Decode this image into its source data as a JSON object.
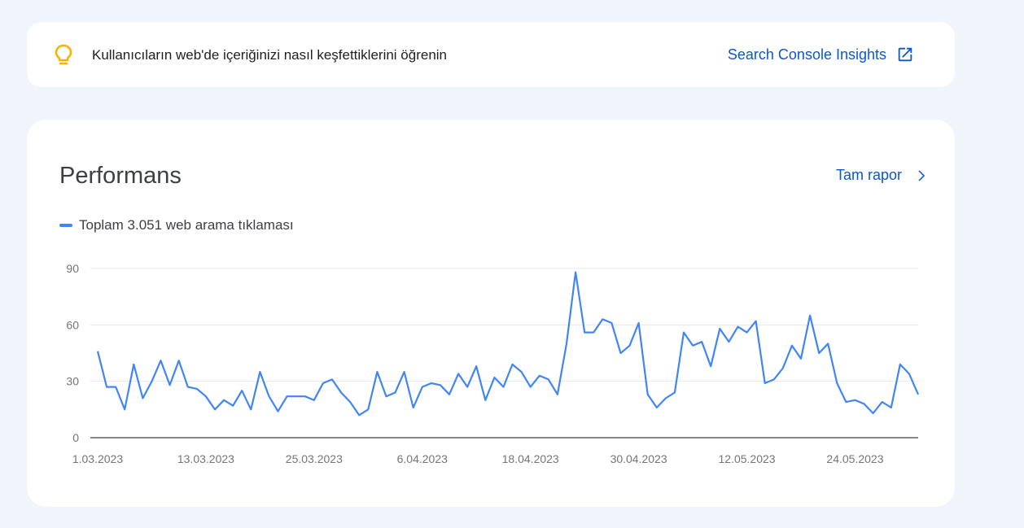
{
  "insights": {
    "icon": "lightbulb-icon",
    "icon_color": "#f4b400",
    "text": "Kullanıcıların web'de içeriğinizi nasıl keşfettiklerini öğrenin",
    "link_label": "Search Console Insights",
    "link_icon": "open-in-new-icon"
  },
  "performance": {
    "title": "Performans",
    "report_link_label": "Tam rapor",
    "report_link_icon": "chevron-right-icon",
    "legend_label": "Toplam 3.051 web arama tıklaması"
  },
  "colors": {
    "accent": "#0b57d0",
    "series": "#4285f4"
  },
  "chart_data": {
    "type": "line",
    "ylim": [
      0,
      90
    ],
    "yticks": [
      0,
      30,
      60,
      90
    ],
    "xtick_labels": [
      "1.03.2023",
      "13.03.2023",
      "25.03.2023",
      "6.04.2023",
      "18.04.2023",
      "30.04.2023",
      "12.05.2023",
      "24.05.2023"
    ],
    "xtick_index": [
      0,
      12,
      24,
      36,
      48,
      60,
      72,
      84
    ],
    "series": [
      {
        "name": "Toplam 3.051 web arama tıklaması",
        "values": [
          46,
          27,
          27,
          15,
          39,
          21,
          30,
          41,
          28,
          41,
          27,
          26,
          22,
          15,
          20,
          17,
          25,
          15,
          35,
          22,
          14,
          22,
          22,
          22,
          20,
          29,
          31,
          24,
          19,
          12,
          15,
          35,
          22,
          24,
          35,
          16,
          27,
          29,
          28,
          23,
          34,
          27,
          38,
          20,
          32,
          27,
          39,
          35,
          27,
          33,
          31,
          23,
          50,
          88,
          56,
          56,
          63,
          61,
          45,
          49,
          61,
          23,
          16,
          21,
          24,
          56,
          49,
          51,
          38,
          58,
          51,
          59,
          56,
          62,
          29,
          31,
          37,
          49,
          42,
          65,
          45,
          50,
          29,
          19,
          20,
          18,
          13,
          19,
          16,
          39,
          34,
          23
        ]
      }
    ]
  }
}
